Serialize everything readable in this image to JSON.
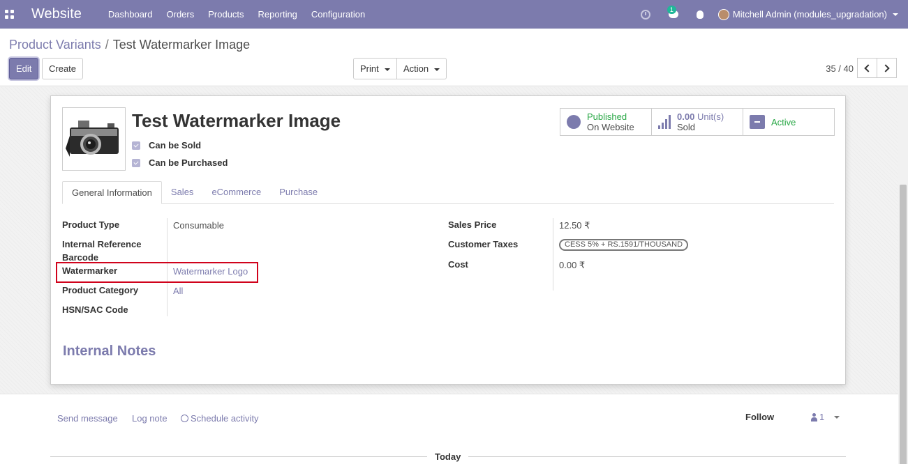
{
  "navbar": {
    "app_name": "Website",
    "menu": [
      "Dashboard",
      "Orders",
      "Products",
      "Reporting",
      "Configuration"
    ],
    "chat_count": "1",
    "user": "Mitchell Admin (modules_upgradation)"
  },
  "control_panel": {
    "breadcrumb_parent": "Product Variants",
    "breadcrumb_separator": "/",
    "breadcrumb_current": "Test Watermarker Image",
    "edit_label": "Edit",
    "create_label": "Create",
    "print_label": "Print",
    "action_label": "Action",
    "pager": "35 / 40"
  },
  "product": {
    "title": "Test Watermarker Image",
    "can_be_sold": "Can be Sold",
    "can_be_purchased": "Can be Purchased"
  },
  "stats": {
    "published_line1": "Published",
    "published_line2": "On Website",
    "sold_value": "0.00",
    "sold_unit": "Unit(s)",
    "sold_label": "Sold",
    "active_label": "Active",
    "published_color": "#28a745",
    "active_color": "#28a745"
  },
  "tabs": [
    "General Information",
    "Sales",
    "eCommerce",
    "Purchase"
  ],
  "fields_left": {
    "product_type_label": "Product Type",
    "product_type_value": "Consumable",
    "internal_ref_label": "Internal Reference",
    "barcode_label": "Barcode",
    "watermarker_label": "Watermarker",
    "watermarker_value": "Watermarker Logo",
    "category_label": "Product Category",
    "category_value": "All",
    "hsn_label": "HSN/SAC Code"
  },
  "fields_right": {
    "sales_price_label": "Sales Price",
    "sales_price_value": "12.50 ₹",
    "customer_taxes_label": "Customer Taxes",
    "customer_taxes_value": "CESS 5% + RS.1591/THOUSAND",
    "cost_label": "Cost",
    "cost_value": "0.00 ₹"
  },
  "internal_notes_title": "Internal Notes",
  "chatter": {
    "send_message": "Send message",
    "log_note": "Log note",
    "schedule_activity": "Schedule activity",
    "follow": "Follow",
    "followers_count": "1",
    "today": "Today"
  }
}
